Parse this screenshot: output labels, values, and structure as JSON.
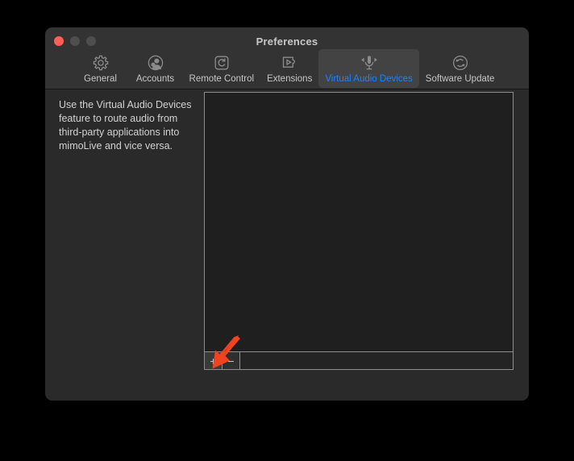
{
  "window": {
    "title": "Preferences",
    "traffic_lights": [
      {
        "name": "close",
        "color": "#ff5f57"
      },
      {
        "name": "minimize",
        "color": "#4e4e4e"
      },
      {
        "name": "maximize",
        "color": "#4e4e4e"
      }
    ]
  },
  "toolbar": {
    "tabs": [
      {
        "label": "General",
        "icon": "gear-icon",
        "selected": false
      },
      {
        "label": "Accounts",
        "icon": "user-account-icon",
        "selected": false
      },
      {
        "label": "Remote Control",
        "icon": "remote-control-icon",
        "selected": false
      },
      {
        "label": "Extensions",
        "icon": "puzzle-play-icon",
        "selected": false
      },
      {
        "label": "Virtual Audio Devices",
        "icon": "microphone-audio-icon",
        "selected": true
      },
      {
        "label": "Software Update",
        "icon": "refresh-sync-icon",
        "selected": false
      }
    ],
    "selected_tab_label": "Virtual Audio Devices",
    "selected_text_color": "#1e82ff"
  },
  "sidebar": {
    "description": "Use the Virtual Audio Devices feature to route audio from third-party applications into mimoLive and vice versa."
  },
  "panel": {
    "list_items": [],
    "list_empty": true,
    "buttons": [
      {
        "label": "+",
        "name": "add-device-button"
      },
      {
        "label": "−",
        "name": "remove-device-button"
      }
    ]
  },
  "annotation": {
    "arrow_color": "#f0431f",
    "points_to": "add-device-button"
  }
}
